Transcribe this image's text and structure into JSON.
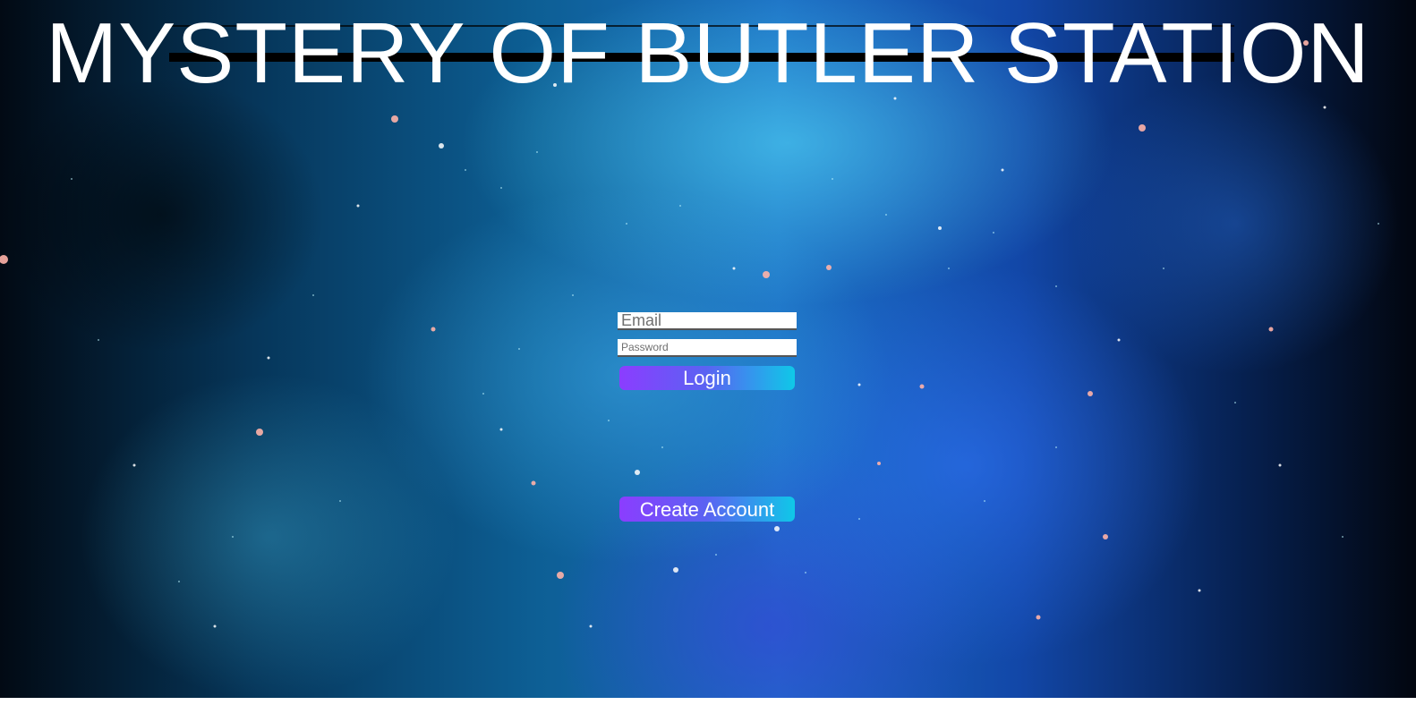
{
  "page": {
    "title": "MYSTERY OF BUTLER STATION"
  },
  "login": {
    "email_placeholder": "Email",
    "password_placeholder": "Password",
    "login_label": "Login"
  },
  "create_account": {
    "label": "Create Account"
  },
  "colors": {
    "button_gradient_start": "#8b3dff",
    "button_gradient_end": "#0fc8e8",
    "title_color": "#ffffff"
  }
}
